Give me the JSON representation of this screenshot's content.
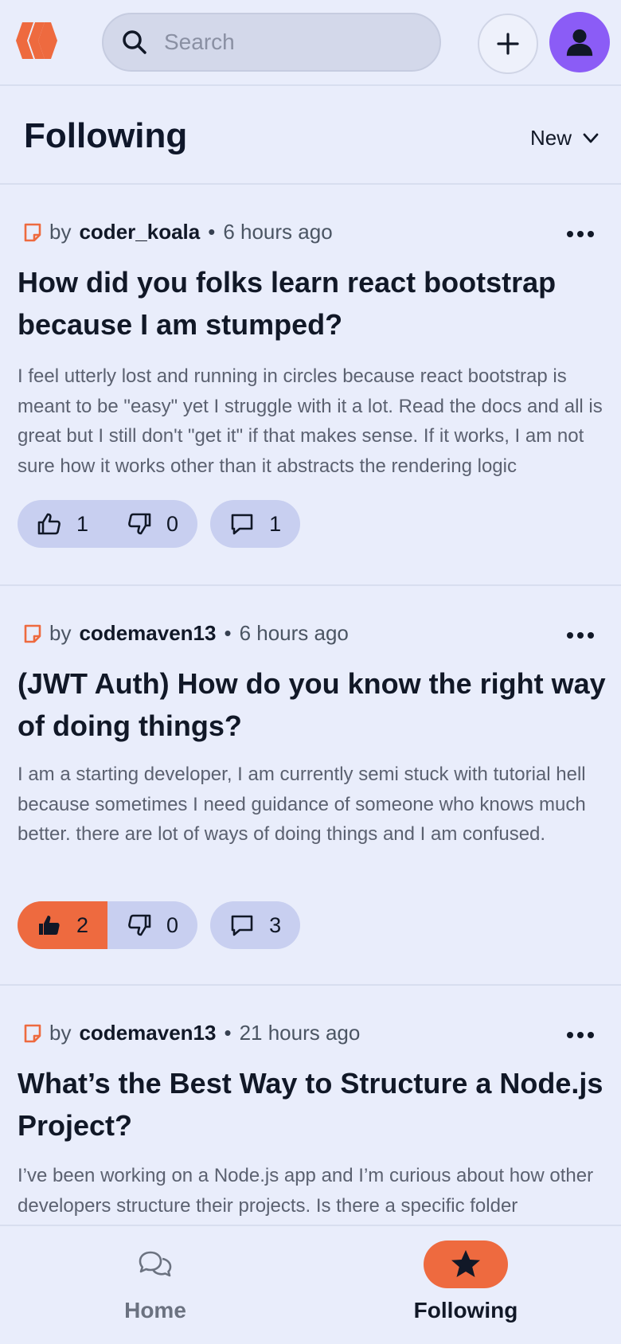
{
  "header": {
    "search_placeholder": "Search"
  },
  "page": {
    "title": "Following",
    "sort_label": "New"
  },
  "posts": [
    {
      "by": "by",
      "author": "coder_koala",
      "separator": "•",
      "time": "6 hours ago",
      "title": "How did you folks learn react bootstrap because I am stumped?",
      "body": "I feel utterly lost and running in circles because react bootstrap is meant to be \"easy\" yet I struggle with it a lot. Read the docs and all is great but I still don't \"get it\" if that makes sense. If it works, I am not sure how it works other than it abstracts the rendering logic",
      "upvotes": "1",
      "downvotes": "0",
      "comments": "1",
      "upvoted": false
    },
    {
      "by": "by",
      "author": "codemaven13",
      "separator": "•",
      "time": "6 hours ago",
      "title": "(JWT Auth) How do you know the right way of doing things?",
      "body": "I am a starting developer, I am currently semi stuck with tutorial hell because sometimes I need guidance of someone who knows much better. there are lot of ways of doing things and I am confused.",
      "upvotes": "2",
      "downvotes": "0",
      "comments": "3",
      "upvoted": true
    },
    {
      "by": "by",
      "author": "codemaven13",
      "separator": "•",
      "time": "21 hours ago",
      "title": "What’s the Best Way to Structure a Node.js Project?",
      "body": "I’ve been working on a Node.js app and I’m curious about how other developers structure their projects. Is there a specific folder"
    }
  ],
  "nav": {
    "home_label": "Home",
    "following_label": "Following",
    "active": "following"
  },
  "colors": {
    "accent": "#ee6a3f",
    "avatar": "#8b5cf6",
    "background": "#e9edfb",
    "pill": "#c8cff0"
  }
}
